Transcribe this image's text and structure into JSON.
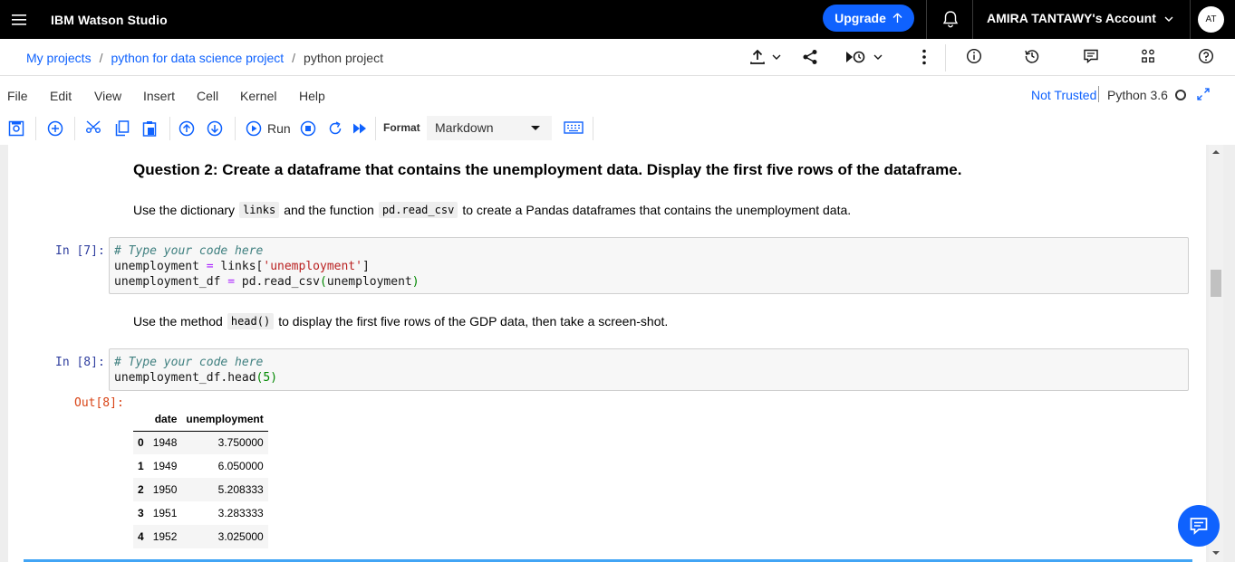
{
  "topbar": {
    "brand": "IBM Watson Studio",
    "upgrade_label": "Upgrade",
    "account_label": "AMIRA TANTAWY's Account",
    "avatar_initials": "AT",
    "upgrade_color": "#0f62fe"
  },
  "breadcrumb": {
    "items": [
      "My projects",
      "python for data science project",
      "python project"
    ],
    "separator": "/"
  },
  "menu": {
    "items": [
      "File",
      "Edit",
      "View",
      "Insert",
      "Cell",
      "Kernel",
      "Help"
    ],
    "trust_status": "Not Trusted",
    "kernel_name": "Python 3.6"
  },
  "toolbar": {
    "run_label": "Run",
    "format_label": "Format",
    "format_value": "Markdown"
  },
  "notebook": {
    "question_heading": "Question 2: Create a dataframe that contains the unemployment data. Display the first five rows of the dataframe.",
    "para1": {
      "t1": "Use the dictionary",
      "c1": "links",
      "t2": "and the function",
      "c2": "pd.read_csv",
      "t3": "to create a Pandas dataframes that contains the unemployment data."
    },
    "cell7": {
      "prompt": "In [7]:",
      "comment": "# Type your code here",
      "l2_var": "unemployment ",
      "l2_op": "=",
      "l2_mid": " links[",
      "l2_str": "'unemployment'",
      "l2_end": "]",
      "l3_var": "unemployment_df ",
      "l3_op": "=",
      "l3_mid": " pd.read_csv",
      "l3_p1": "(",
      "l3_arg": "unemployment",
      "l3_p2": ")"
    },
    "para2": {
      "t1": "Use the method",
      "c1": "head()",
      "t2": "to display the first five rows of the GDP data, then take a screen-shot."
    },
    "cell8": {
      "prompt": "In [8]:",
      "comment": "# Type your code here",
      "l2_mid": "unemployment_df.head",
      "l2_p1": "(",
      "l2_num": "5",
      "l2_p2": ")",
      "out_prompt": "Out[8]:"
    },
    "dataframe": {
      "columns": [
        "",
        "date",
        "unemployment"
      ],
      "rows": [
        {
          "index": "0",
          "date": "1948",
          "unemployment": "3.750000"
        },
        {
          "index": "1",
          "date": "1949",
          "unemployment": "6.050000"
        },
        {
          "index": "2",
          "date": "1950",
          "unemployment": "5.208333"
        },
        {
          "index": "3",
          "date": "1951",
          "unemployment": "3.283333"
        },
        {
          "index": "4",
          "date": "1952",
          "unemployment": "3.025000"
        }
      ]
    }
  }
}
